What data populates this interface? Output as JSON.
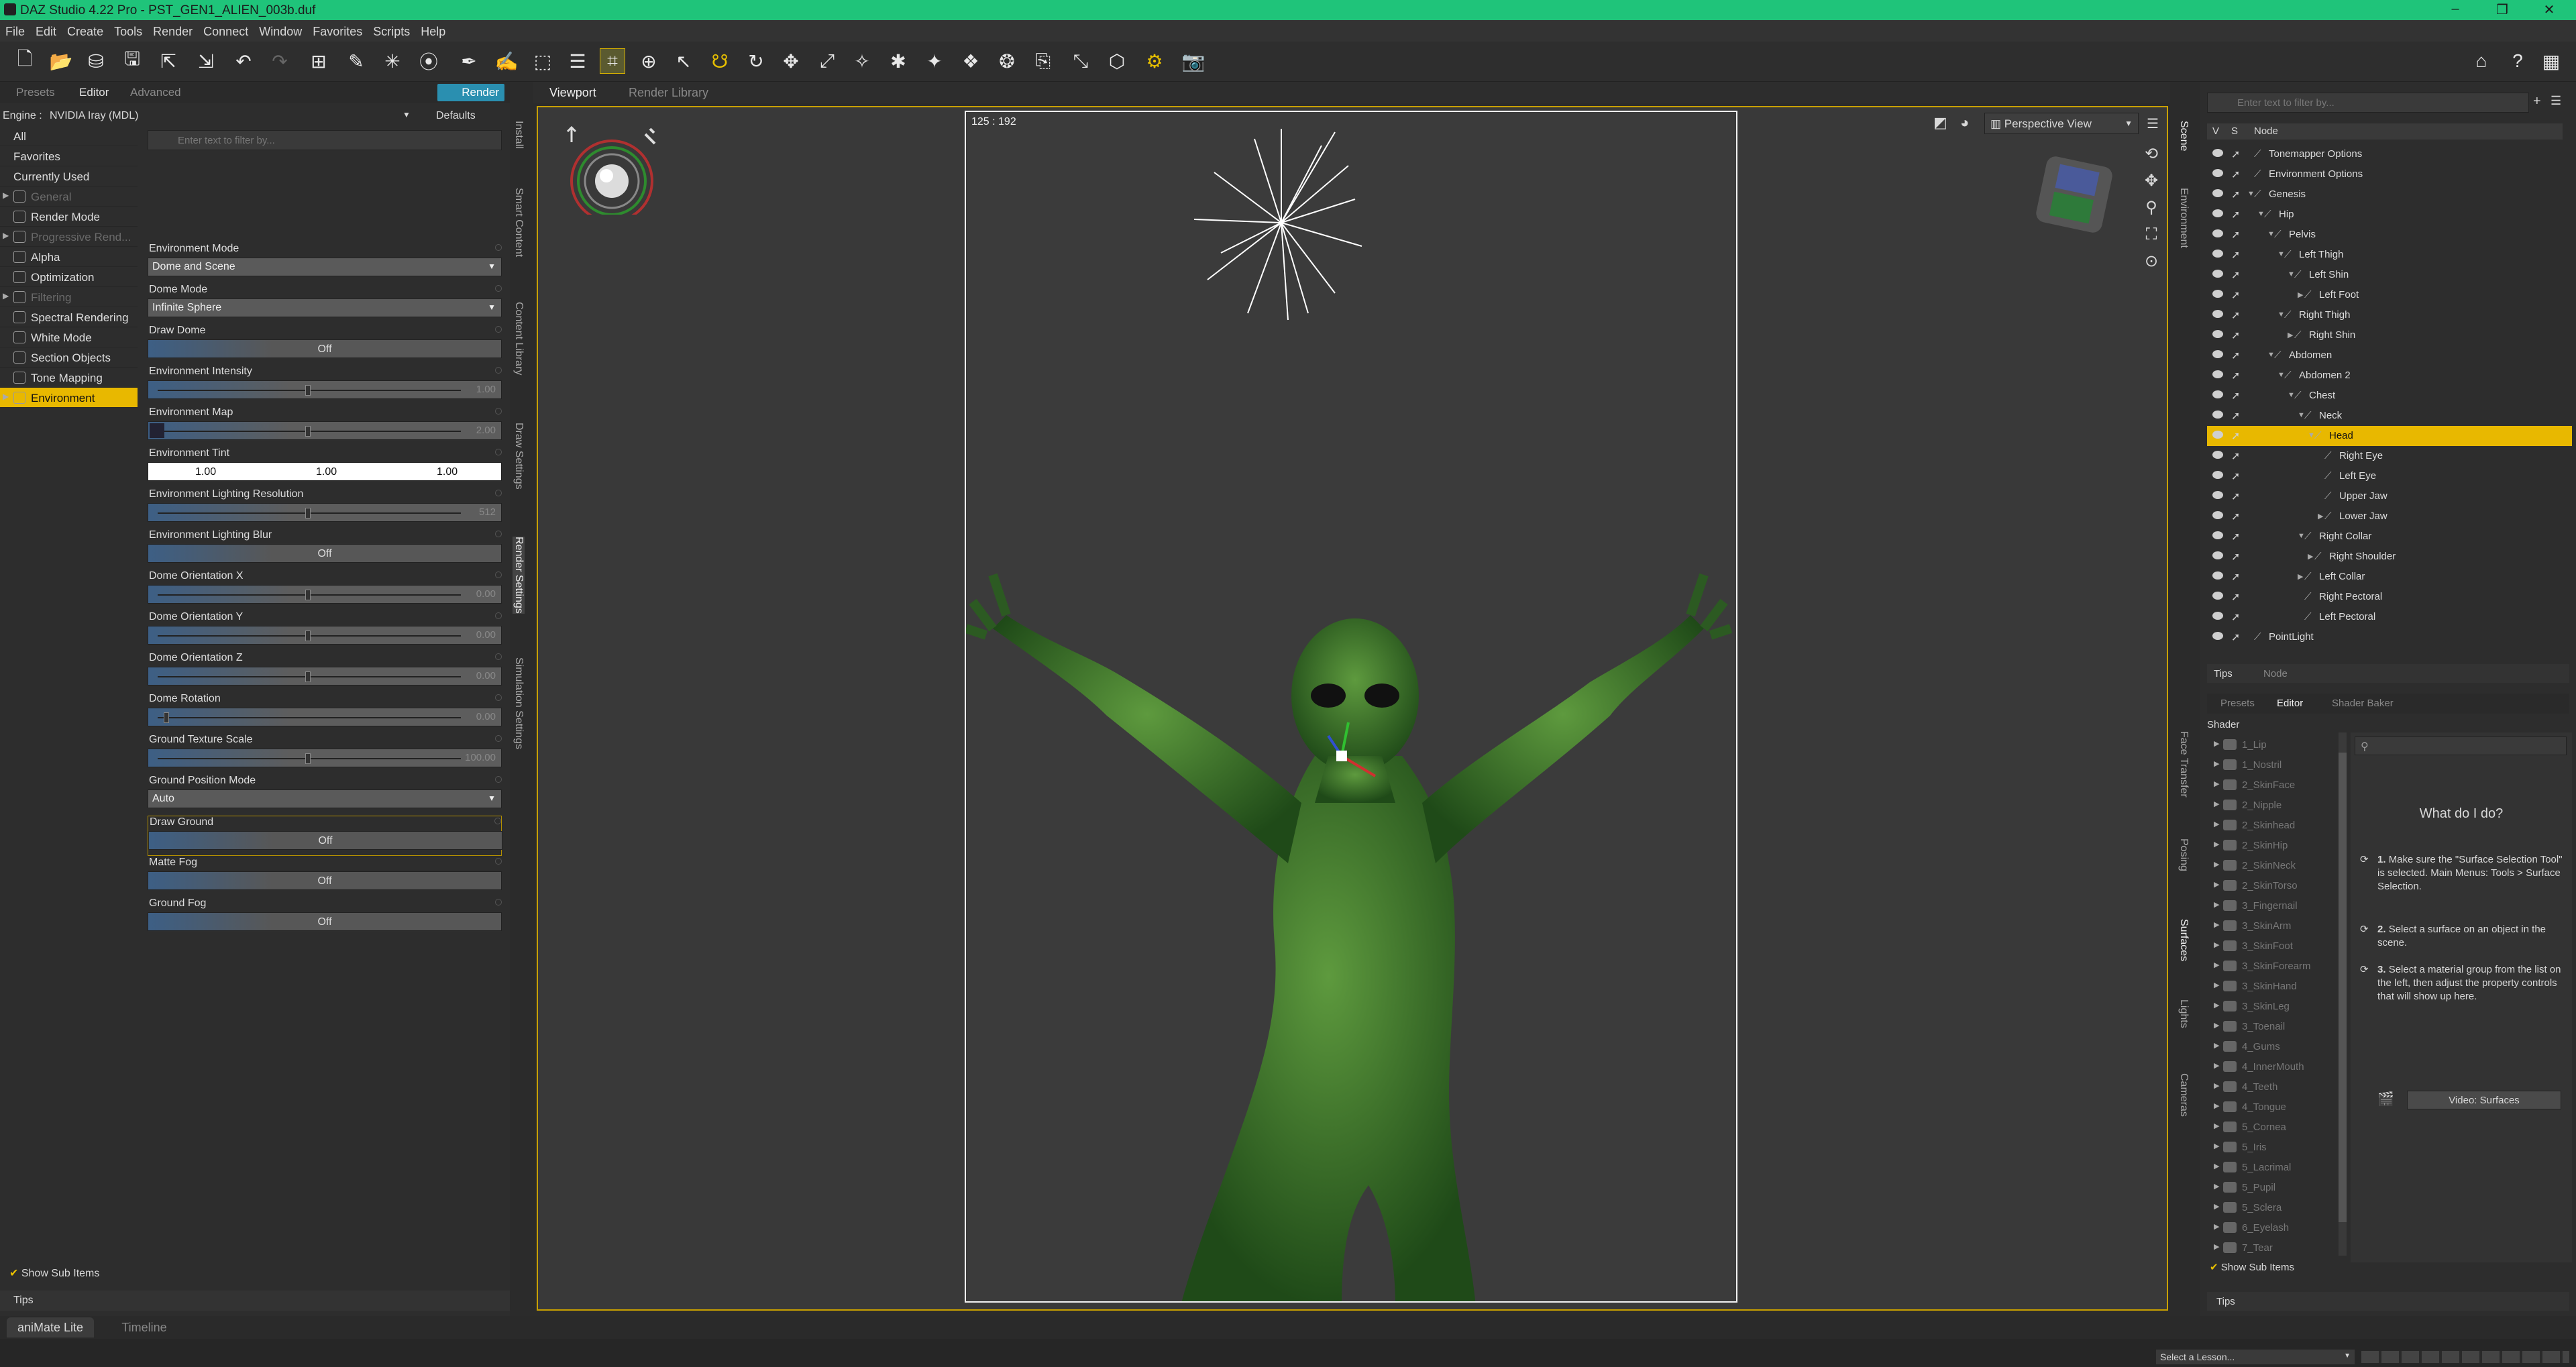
{
  "app": {
    "title": "DAZ Studio 4.22 Pro - PST_GEN1_ALIEN_003b.duf"
  },
  "menu": [
    "File",
    "Edit",
    "Create",
    "Tools",
    "Render",
    "Connect",
    "Window",
    "Favorites",
    "Scripts",
    "Help"
  ],
  "left": {
    "tabs": [
      "Presets",
      "Editor",
      "Advanced"
    ],
    "render_button": "Render",
    "engine_label": "Engine :",
    "engine_value": "NVIDIA Iray (MDL)",
    "defaults": "Defaults",
    "filter_placeholder": "Enter text to filter by...",
    "categories": [
      {
        "label": "All",
        "dim": false,
        "sel": false,
        "icon": false,
        "tri": false
      },
      {
        "label": "Favorites",
        "dim": false,
        "sel": false,
        "icon": false,
        "tri": false
      },
      {
        "label": "Currently Used",
        "dim": false,
        "sel": false,
        "icon": false,
        "tri": false
      },
      {
        "label": "General",
        "dim": true,
        "sel": false,
        "icon": true,
        "tri": true
      },
      {
        "label": "Render Mode",
        "dim": false,
        "sel": false,
        "icon": true,
        "tri": false
      },
      {
        "label": "Progressive Rend...",
        "dim": true,
        "sel": false,
        "icon": true,
        "tri": true
      },
      {
        "label": "Alpha",
        "dim": false,
        "sel": false,
        "icon": true,
        "tri": false
      },
      {
        "label": "Optimization",
        "dim": false,
        "sel": false,
        "icon": true,
        "tri": false
      },
      {
        "label": "Filtering",
        "dim": true,
        "sel": false,
        "icon": true,
        "tri": true
      },
      {
        "label": "Spectral Rendering",
        "dim": false,
        "sel": false,
        "icon": true,
        "tri": false
      },
      {
        "label": "White Mode",
        "dim": false,
        "sel": false,
        "icon": true,
        "tri": false
      },
      {
        "label": "Section Objects",
        "dim": false,
        "sel": false,
        "icon": true,
        "tri": false
      },
      {
        "label": "Tone Mapping",
        "dim": false,
        "sel": false,
        "icon": true,
        "tri": false
      },
      {
        "label": "Environment",
        "dim": false,
        "sel": true,
        "icon": true,
        "tri": true
      }
    ],
    "props": {
      "env_mode": {
        "label": "Environment Mode",
        "value": "Dome and Scene"
      },
      "dome_mode": {
        "label": "Dome Mode",
        "value": "Infinite Sphere"
      },
      "draw_dome": {
        "label": "Draw Dome",
        "value": "Off"
      },
      "env_intensity": {
        "label": "Environment Intensity",
        "value": "1.00",
        "level": 0.5
      },
      "env_map": {
        "label": "Environment Map",
        "value": "2.00",
        "level": 0.5
      },
      "env_tint": {
        "label": "Environment Tint",
        "r": "1.00",
        "g": "1.00",
        "b": "1.00"
      },
      "env_light_res": {
        "label": "Environment Lighting Resolution",
        "value": "512",
        "level": 0.5
      },
      "env_light_blur": {
        "label": "Environment Lighting Blur",
        "value": "Off"
      },
      "dome_ox": {
        "label": "Dome Orientation X",
        "value": "0.00",
        "level": 0.5
      },
      "dome_oy": {
        "label": "Dome Orientation Y",
        "value": "0.00",
        "level": 0.5
      },
      "dome_oz": {
        "label": "Dome Orientation Z",
        "value": "0.00",
        "level": 0.5
      },
      "dome_rot": {
        "label": "Dome Rotation",
        "value": "0.00",
        "level": 0.02
      },
      "ground_tex": {
        "label": "Ground Texture Scale",
        "value": "100.00",
        "level": 0.5
      },
      "ground_pos": {
        "label": "Ground Position Mode",
        "value": "Auto"
      },
      "draw_ground": {
        "label": "Draw Ground",
        "value": "Off"
      },
      "matte_fog": {
        "label": "Matte Fog",
        "value": "Off"
      },
      "ground_fog": {
        "label": "Ground Fog",
        "value": "Off"
      }
    },
    "show_sub_items": "Show Sub Items",
    "tips": "Tips",
    "vtabs": [
      "Install",
      "Smart Content",
      "Content Library",
      "Draw Settings",
      "Render Settings",
      "Simulation Settings"
    ]
  },
  "viewport": {
    "tabs": [
      "Viewport",
      "Render Library"
    ],
    "dims": "125 : 192",
    "view": "Perspective View"
  },
  "scene": {
    "filter_placeholder": "Enter text to filter by...",
    "col_v": "V",
    "col_s": "S",
    "col_node": "Node",
    "nodes": [
      {
        "label": "Tonemapper Options",
        "indent": 0,
        "tri": ""
      },
      {
        "label": "Environment Options",
        "indent": 0,
        "tri": ""
      },
      {
        "label": "Genesis",
        "indent": 0,
        "tri": "▼"
      },
      {
        "label": "Hip",
        "indent": 1,
        "tri": "▼"
      },
      {
        "label": "Pelvis",
        "indent": 2,
        "tri": "▼"
      },
      {
        "label": "Left Thigh",
        "indent": 3,
        "tri": "▼"
      },
      {
        "label": "Left Shin",
        "indent": 4,
        "tri": "▼"
      },
      {
        "label": "Left Foot",
        "indent": 5,
        "tri": "▶"
      },
      {
        "label": "Right Thigh",
        "indent": 3,
        "tri": "▼"
      },
      {
        "label": "Right Shin",
        "indent": 4,
        "tri": "▶"
      },
      {
        "label": "Abdomen",
        "indent": 2,
        "tri": "▼"
      },
      {
        "label": "Abdomen 2",
        "indent": 3,
        "tri": "▼"
      },
      {
        "label": "Chest",
        "indent": 4,
        "tri": "▼"
      },
      {
        "label": "Neck",
        "indent": 5,
        "tri": "▼"
      },
      {
        "label": "Head",
        "indent": 6,
        "tri": "▼",
        "sel": true
      },
      {
        "label": "Right Eye",
        "indent": 7,
        "tri": ""
      },
      {
        "label": "Left Eye",
        "indent": 7,
        "tri": ""
      },
      {
        "label": "Upper Jaw",
        "indent": 7,
        "tri": ""
      },
      {
        "label": "Lower Jaw",
        "indent": 7,
        "tri": "▶"
      },
      {
        "label": "Right Collar",
        "indent": 5,
        "tri": "▼"
      },
      {
        "label": "Right Shoulder",
        "indent": 6,
        "tri": "▶"
      },
      {
        "label": "Left Collar",
        "indent": 5,
        "tri": "▶"
      },
      {
        "label": "Right Pectoral",
        "indent": 5,
        "tri": ""
      },
      {
        "label": "Left Pectoral",
        "indent": 5,
        "tri": ""
      },
      {
        "label": "PointLight",
        "indent": 0,
        "tri": ""
      }
    ],
    "bottom_tabs": [
      "Tips",
      "Node"
    ],
    "vtabs": [
      "Scene",
      "Environment"
    ]
  },
  "surfaces": {
    "tabs": [
      "Presets",
      "Editor",
      "Shader Baker"
    ],
    "shader_label": "Shader",
    "items": [
      "1_Lip",
      "1_Nostril",
      "2_SkinFace",
      "2_Nipple",
      "2_Skinhead",
      "2_SkinHip",
      "2_SkinNeck",
      "2_SkinTorso",
      "3_Fingernail",
      "3_SkinArm",
      "3_SkinFoot",
      "3_SkinForearm",
      "3_SkinHand",
      "3_SkinLeg",
      "3_Toenail",
      "4_Gums",
      "4_InnerMouth",
      "4_Teeth",
      "4_Tongue",
      "5_Cornea",
      "5_Iris",
      "5_Lacrimal",
      "5_Pupil",
      "5_Sclera",
      "6_Eyelash",
      "7_Tear"
    ],
    "help_title": "What do I do?",
    "help": [
      {
        "n": "1.",
        "b": "Make sure the \"Surface Selection Tool\" is selected.",
        "t": "Main Menus: Tools > Surface Selection."
      },
      {
        "n": "2.",
        "b": "Select a surface on an object in the scene.",
        "t": ""
      },
      {
        "n": "3.",
        "b": "Select a material group from the list on the left, then adjust the property controls that will show up here.",
        "t": ""
      }
    ],
    "video_btn": "Video: Surfaces",
    "show_sub_items": "Show Sub Items",
    "tips": "Tips",
    "vtabs": [
      "Face Transfer",
      "Posing",
      "Surfaces",
      "Lights",
      "Cameras"
    ]
  },
  "bottom": {
    "tabs": [
      "aniMate Lite",
      "Timeline"
    ],
    "lesson": "Select a Lesson..."
  }
}
